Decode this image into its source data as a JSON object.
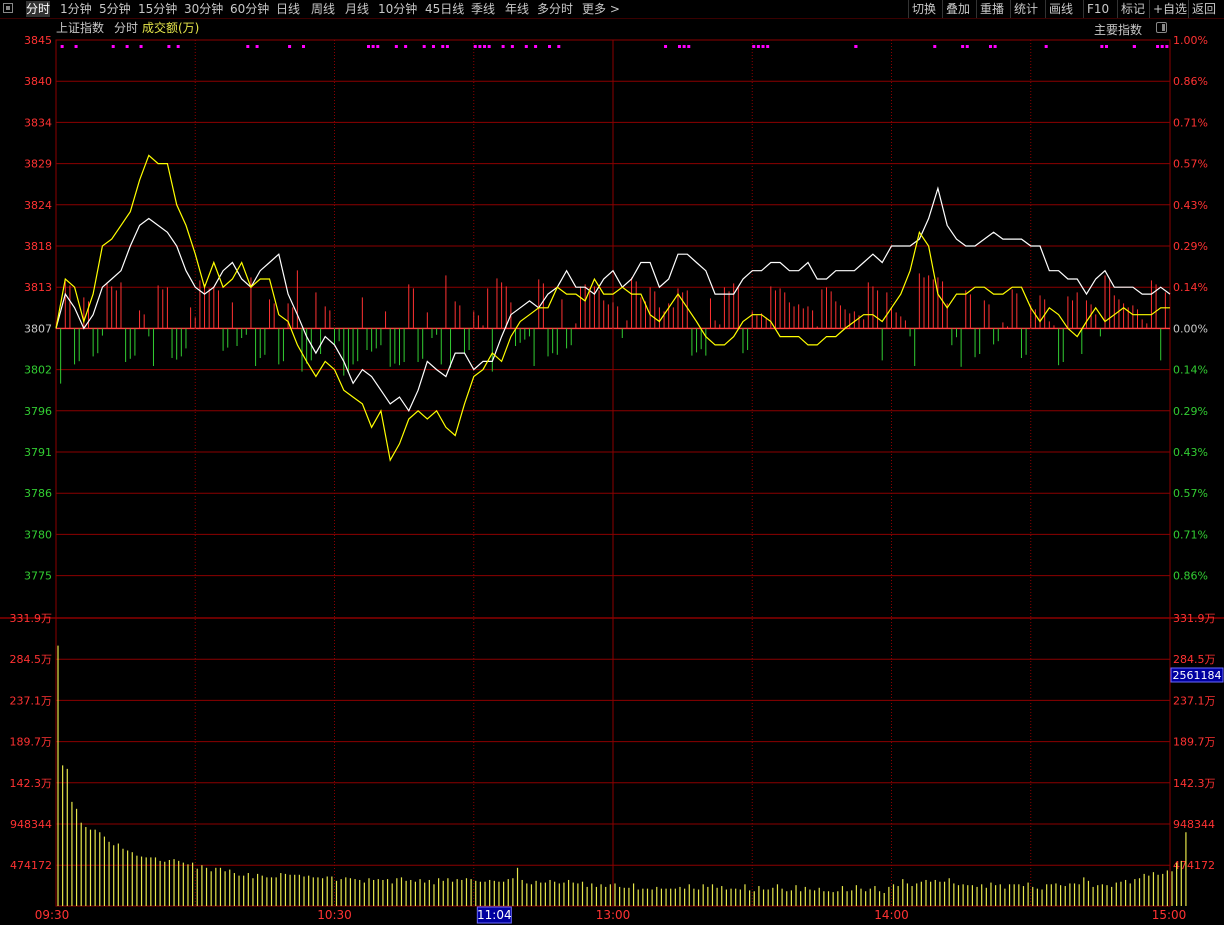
{
  "toolbar": {
    "period_tabs": [
      "分时",
      "1分钟",
      "5分钟",
      "15分钟",
      "30分钟",
      "60分钟",
      "日线",
      "周线",
      "月线",
      "10分钟",
      "45日线",
      "季线",
      "年线",
      "多分时",
      "更多 >"
    ],
    "active_tab": "分时",
    "right_buttons": [
      "切换",
      "叠加",
      "重播",
      "统计",
      "画线",
      "F10",
      "标记",
      "+自选",
      "返回"
    ]
  },
  "subheader": {
    "index_name": "上证指数",
    "view_label": "分时",
    "volume_label": "成交额(万)",
    "main_index_button": "主要指数"
  },
  "colors": {
    "background": "#000000",
    "grid": "#8b0000",
    "up": "#ff3232",
    "down": "#32cd32",
    "price_line": "#ffffff",
    "avg_line": "#ffff00",
    "volume": "#e6e64a",
    "marker": "#ff00ff",
    "cursor_label_bg": "#0000a0"
  },
  "cursor": {
    "time": "11:04",
    "volume_readout": "2561184"
  },
  "chart_data": [
    {
      "type": "line",
      "title": "上证指数 分时",
      "x_unit": "minutes since 09:30 (trading time, 240 total)",
      "x_ticks": [
        "09:30",
        "10:30",
        "11:04",
        "13:00",
        "14:00",
        "15:00"
      ],
      "prev_close": 3807,
      "ylim": [
        3771,
        3845
      ],
      "left_ticks": [
        "3845",
        "3840",
        "3834",
        "3829",
        "3824",
        "3818",
        "3813",
        "3807",
        "3802",
        "3796",
        "3791",
        "3786",
        "3780",
        "3775"
      ],
      "right_ticks": [
        "1.00%",
        "0.86%",
        "0.71%",
        "0.57%",
        "0.43%",
        "0.29%",
        "0.14%",
        "0.00%",
        "0.14%",
        "0.29%",
        "0.43%",
        "0.57%",
        "0.71%",
        "0.86%"
      ],
      "series": [
        {
          "name": "价格",
          "x": [
            0,
            2,
            4,
            6,
            8,
            10,
            12,
            14,
            16,
            18,
            20,
            22,
            24,
            26,
            28,
            30,
            32,
            34,
            36,
            38,
            40,
            42,
            44,
            46,
            48,
            50,
            52,
            54,
            56,
            58,
            60,
            62,
            64,
            66,
            68,
            70,
            72,
            74,
            76,
            78,
            80,
            82,
            84,
            86,
            88,
            90,
            92,
            94,
            96,
            98,
            100,
            102,
            104,
            106,
            108,
            110,
            112,
            114,
            116,
            118,
            120,
            122,
            124,
            126,
            128,
            130,
            132,
            134,
            136,
            138,
            140,
            142,
            144,
            146,
            148,
            150,
            152,
            154,
            156,
            158,
            160,
            162,
            164,
            166,
            168,
            170,
            172,
            174,
            176,
            178,
            180,
            182,
            184,
            186,
            188,
            190,
            192,
            194,
            196,
            198,
            200,
            202,
            204,
            206,
            208,
            210,
            212,
            214,
            216,
            218,
            220,
            222,
            224,
            226,
            228,
            230,
            232,
            234,
            236,
            238,
            240
          ],
          "y": [
            3807,
            3812,
            3810,
            3807,
            3809,
            3813,
            3814,
            3815,
            3818,
            3821,
            3822,
            3821,
            3820,
            3818,
            3815,
            3813,
            3812,
            3813,
            3815,
            3816,
            3814,
            3813,
            3815,
            3816,
            3817,
            3812,
            3809,
            3806,
            3804,
            3806,
            3805,
            3803,
            3800,
            3802,
            3801,
            3799,
            3797,
            3798,
            3796,
            3799,
            3803,
            3802,
            3801,
            3804,
            3804,
            3802,
            3803,
            3803,
            3806,
            3809,
            3810,
            3811,
            3810,
            3812,
            3813,
            3815,
            3813,
            3813,
            3812,
            3814,
            3815,
            3813,
            3814,
            3816,
            3816,
            3813,
            3814,
            3817,
            3817,
            3816,
            3815,
            3812,
            3812,
            3812,
            3814,
            3815,
            3815,
            3816,
            3816,
            3815,
            3815,
            3816,
            3814,
            3814,
            3815,
            3815,
            3815,
            3816,
            3817,
            3816,
            3818,
            3818,
            3818,
            3819,
            3822,
            3826,
            3821,
            3819,
            3818,
            3818,
            3819,
            3820,
            3819,
            3819,
            3819,
            3818,
            3818,
            3815,
            3815,
            3814,
            3814,
            3812,
            3814,
            3815,
            3813,
            3813,
            3813,
            3812,
            3812,
            3813,
            3812
          ]
        },
        {
          "name": "均价",
          "x": [
            0,
            2,
            4,
            6,
            8,
            10,
            12,
            14,
            16,
            18,
            20,
            22,
            24,
            26,
            28,
            30,
            32,
            34,
            36,
            38,
            40,
            42,
            44,
            46,
            48,
            50,
            52,
            54,
            56,
            58,
            60,
            62,
            64,
            66,
            68,
            70,
            72,
            74,
            76,
            78,
            80,
            82,
            84,
            86,
            88,
            90,
            92,
            94,
            96,
            98,
            100,
            102,
            104,
            106,
            108,
            110,
            112,
            114,
            116,
            118,
            120,
            122,
            124,
            126,
            128,
            130,
            132,
            134,
            136,
            138,
            140,
            142,
            144,
            146,
            148,
            150,
            152,
            154,
            156,
            158,
            160,
            162,
            164,
            166,
            168,
            170,
            172,
            174,
            176,
            178,
            180,
            182,
            184,
            186,
            188,
            190,
            192,
            194,
            196,
            198,
            200,
            202,
            204,
            206,
            208,
            210,
            212,
            214,
            216,
            218,
            220,
            222,
            224,
            226,
            228,
            230,
            232,
            234,
            236,
            238,
            240
          ],
          "y": [
            3807,
            3814,
            3813,
            3808,
            3812,
            3818,
            3819,
            3821,
            3823,
            3827,
            3830,
            3829,
            3829,
            3824,
            3821,
            3817,
            3813,
            3816,
            3813,
            3814,
            3816,
            3813,
            3814,
            3814,
            3809,
            3808,
            3805,
            3803,
            3801,
            3803,
            3802,
            3799,
            3798,
            3797,
            3794,
            3796,
            3790,
            3792,
            3795,
            3796,
            3795,
            3796,
            3794,
            3793,
            3797,
            3801,
            3802,
            3804,
            3803,
            3806,
            3808,
            3809,
            3810,
            3810,
            3813,
            3812,
            3812,
            3811,
            3814,
            3812,
            3812,
            3813,
            3812,
            3812,
            3809,
            3808,
            3810,
            3812,
            3810,
            3808,
            3806,
            3805,
            3805,
            3806,
            3808,
            3809,
            3809,
            3808,
            3806,
            3806,
            3806,
            3805,
            3805,
            3806,
            3806,
            3807,
            3808,
            3809,
            3809,
            3808,
            3810,
            3812,
            3815,
            3820,
            3818,
            3812,
            3810,
            3812,
            3812,
            3813,
            3813,
            3812,
            3812,
            3813,
            3813,
            3810,
            3808,
            3810,
            3809,
            3807,
            3806,
            3808,
            3810,
            3808,
            3809,
            3810,
            3809,
            3809,
            3809,
            3810,
            3810
          ]
        }
      ]
    },
    {
      "type": "bar",
      "title": "成交额(万)",
      "x_unit": "minutes since 09:30",
      "ylim": [
        0,
        331.9
      ],
      "tick_labels": [
        "331.9万",
        "284.5万",
        "237.1万",
        "189.7万",
        "142.3万",
        "948344",
        "474172"
      ],
      "values_wan": [
        300.0,
        162.0,
        158.0,
        120.0,
        112.0,
        96.0,
        91.0,
        88.0,
        88.0,
        85.0,
        80.0,
        74.0,
        70.0,
        72.0,
        66.0,
        64.0,
        62.0,
        58.0,
        57.0,
        56.0,
        56.0,
        56.0,
        52.0,
        51.0,
        53.0,
        54.0,
        52.0,
        50.0,
        48.0,
        50.0,
        43.0,
        47.0,
        44.0,
        40.0,
        44.0,
        44.0,
        40.0,
        42.0,
        38.0,
        35.0,
        35.0,
        38.0,
        32.0,
        37.0,
        35.0,
        33.0,
        33.0,
        33.0,
        38.0,
        37.0,
        36.0,
        36.0,
        36.0,
        34.0,
        35.0,
        33.0,
        33.0,
        32.0,
        34.0,
        34.0,
        29.0,
        31.0,
        33.0,
        32.0,
        31.0,
        30.0,
        27.0,
        32.0,
        30.0,
        31.0,
        30.0,
        31.0,
        26.0,
        32.0,
        33.0,
        29.0,
        30.0,
        28.0,
        31.0,
        27.0,
        30.0,
        25.0,
        32.0,
        29.0,
        32.0,
        28.0,
        31.0,
        30.0,
        32.0,
        31.0,
        29.0,
        28.0,
        28.0,
        30.0,
        29.0,
        28.0,
        28.0,
        31.0,
        32.0,
        44.0,
        30.0,
        26.0,
        25.0,
        29.0,
        27.0,
        27.0,
        30.0,
        28.0,
        26.0,
        27.0,
        30.0,
        27.0,
        26.0,
        28.0,
        22.0,
        26.0,
        22.0,
        25.0,
        22.0,
        25.0,
        26.0,
        22.0,
        21.0,
        21.0,
        26.0,
        19.0,
        20.0,
        20.0,
        19.0,
        22.0,
        20.0,
        20.0,
        20.0,
        20.0,
        22.0,
        20.0,
        25.0,
        20.0,
        19.0,
        25.0,
        22.0,
        25.0,
        21.0,
        23.0,
        19.0,
        20.0,
        20.0,
        19.0,
        25.0,
        18.0,
        17.0,
        23.0,
        19.0,
        19.0,
        21.0,
        25.0,
        20.0,
        17.0,
        18.0,
        24.0,
        17.0,
        22.0,
        19.0,
        18.0,
        21.0,
        17.0,
        17.0,
        16.0,
        17.0,
        23.0,
        17.0,
        18.0,
        24.0,
        20.0,
        17.0,
        20.0,
        23.0,
        17.0,
        15.0,
        22.0,
        25.0,
        23.0,
        31.0,
        26.0,
        23.0,
        26.0,
        28.0,
        30.0,
        28.0,
        30.0,
        28.0,
        28.0,
        32.0,
        26.0,
        24.0,
        25.0,
        24.0,
        24.0,
        22.0,
        25.0,
        21.0,
        27.0,
        24.0,
        25.0,
        20.0,
        25.0,
        25.0,
        25.0,
        23.0,
        27.0,
        22.0,
        20.0,
        19.0,
        25.0,
        25.0,
        26.0,
        24.0,
        23.0,
        26.0,
        26.0,
        25.0,
        33.0,
        29.0,
        22.0,
        24.0,
        25.0,
        24.0,
        22.0,
        27.0,
        28.0,
        30.0,
        26.0,
        31.0,
        32.0,
        37.0,
        35.0,
        39.0,
        36.0,
        37.0,
        41.0,
        40.0,
        50.0,
        52.0,
        85.0
      ]
    }
  ]
}
